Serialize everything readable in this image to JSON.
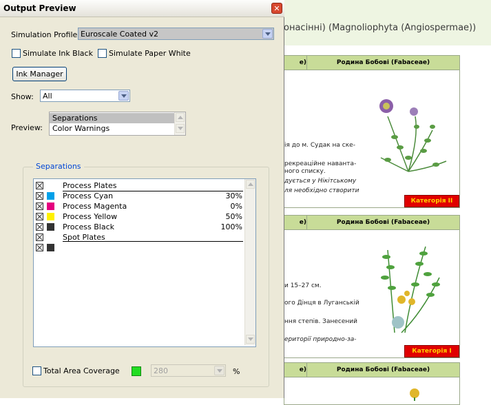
{
  "background_doc": {
    "header_text": "онасінні) (Magnoliophyta (Angiospermae))",
    "cards": [
      {
        "head_left": "e)",
        "head_right": "Родина Бобові (Fabaceae)",
        "lines": [
          {
            "text": "ія до м. Судак на ске-",
            "italic": false
          },
          {
            "text": "рекреаційне наванта-",
            "italic": false
          },
          {
            "text": "ного списку.",
            "italic": false
          },
          {
            "text": "дується у Нікітському",
            "italic": true
          },
          {
            "text": "ля необхідно створити",
            "italic": true
          }
        ],
        "category": "Категорія II"
      },
      {
        "head_left": "e)",
        "head_right": "Родина Бобові (Fabaceae)",
        "lines": [
          {
            "text": "и 15–27 см.",
            "italic": false
          },
          {
            "text": "ого Дінця в Луганській",
            "italic": false
          },
          {
            "text": "ння степів. Занесений",
            "italic": false
          },
          {
            "text": "ериторії природно-за-",
            "italic": true
          }
        ],
        "category": "Категорія I"
      },
      {
        "head_left": "e)",
        "head_right": "Родина Бобові (Fabaceae)"
      }
    ]
  },
  "dialog": {
    "title": "Output Preview",
    "close_label": "✕",
    "simulation_profile_label": "Simulation Profile:",
    "simulation_profile_value": "Euroscale Coated v2",
    "simulate_ink_black_label": "Simulate Ink Black",
    "simulate_paper_white_label": "Simulate Paper White",
    "ink_manager_label": "Ink Manager",
    "show_label": "Show:",
    "show_value": "All",
    "preview_label": "Preview:",
    "preview_options": [
      "Separations",
      "Color Warnings"
    ],
    "separations_group_title": "Separations",
    "separations": [
      {
        "name": "Process Plates",
        "pct": "",
        "color": "",
        "underline": true
      },
      {
        "name": "Process Cyan",
        "pct": "30%",
        "color": "#00a0e9"
      },
      {
        "name": "Process Magenta",
        "pct": "0%",
        "color": "#e4007f"
      },
      {
        "name": "Process Yellow",
        "pct": "50%",
        "color": "#fff100"
      },
      {
        "name": "Process Black",
        "pct": "100%",
        "color": "#333333",
        "underline": true
      },
      {
        "name": "Spot Plates",
        "pct": "",
        "color": ""
      },
      {
        "name": "",
        "pct": "",
        "color": "#333333"
      }
    ],
    "total_area_coverage_label": "Total Area Coverage",
    "total_area_coverage_value": "280",
    "percent_sign": "%",
    "coverage_color": "#22dd22"
  }
}
